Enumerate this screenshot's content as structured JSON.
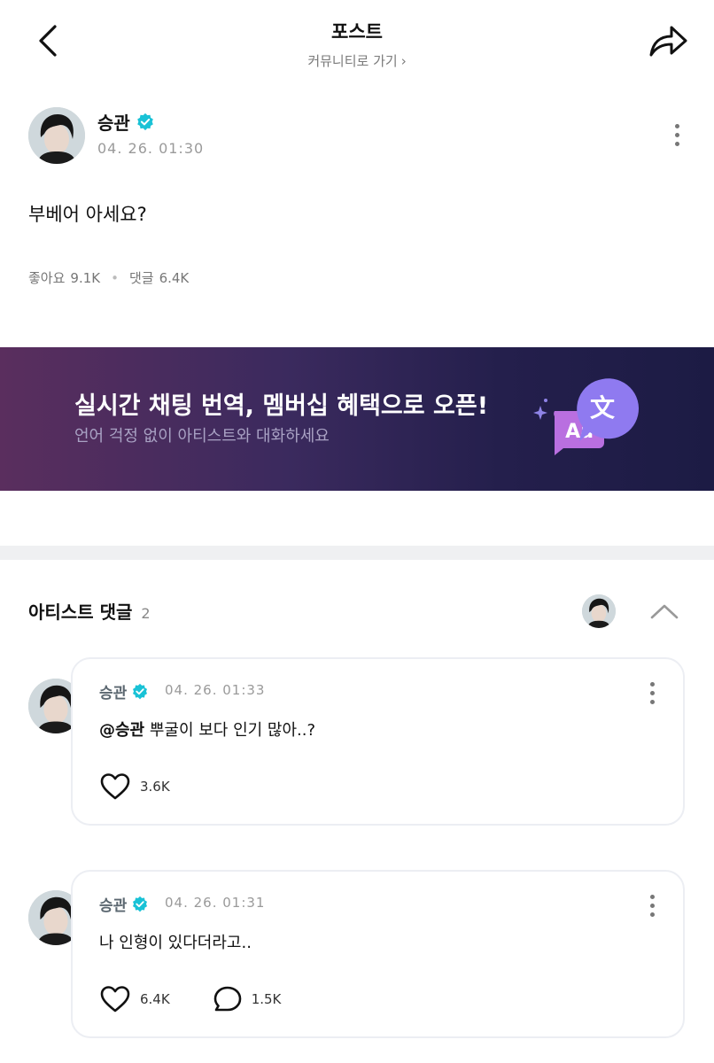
{
  "header": {
    "title": "포스트",
    "community_link": "커뮤니티로 가기",
    "back_icon": "chevron-left-icon",
    "share_icon": "share-arrow-icon"
  },
  "post": {
    "author": "승관",
    "time": "04. 26. 01:30",
    "body": "부베어 아세요?",
    "likes_label": "좋아요",
    "likes": "9.1K",
    "comments_label": "댓글",
    "comments": "6.4K"
  },
  "banner": {
    "title": "실시간 채팅 번역, 멤버십 혜택으로 오픈!",
    "subtitle": "언어 걱정 없이 아티스트와 대화하세요",
    "art_en": "Aa",
    "art_zh": "文"
  },
  "artist_comments": {
    "title": "아티스트 댓글",
    "count": "2",
    "items": [
      {
        "author": "승관",
        "time": "04. 26. 01:33",
        "mention": "@승관",
        "text": " 뿌굴이 보다 인기 많아..?",
        "likes": "3.6K",
        "replies": null
      },
      {
        "author": "승관",
        "time": "04. 26. 01:31",
        "mention": "",
        "text": "나 인형이 있다더라고..",
        "likes": "6.4K",
        "replies": "1.5K"
      }
    ]
  },
  "colors": {
    "verified": "#19c2d6",
    "banner_start": "#5a2e5e",
    "banner_end": "#1c1b44",
    "divider": "#eff0f2"
  }
}
